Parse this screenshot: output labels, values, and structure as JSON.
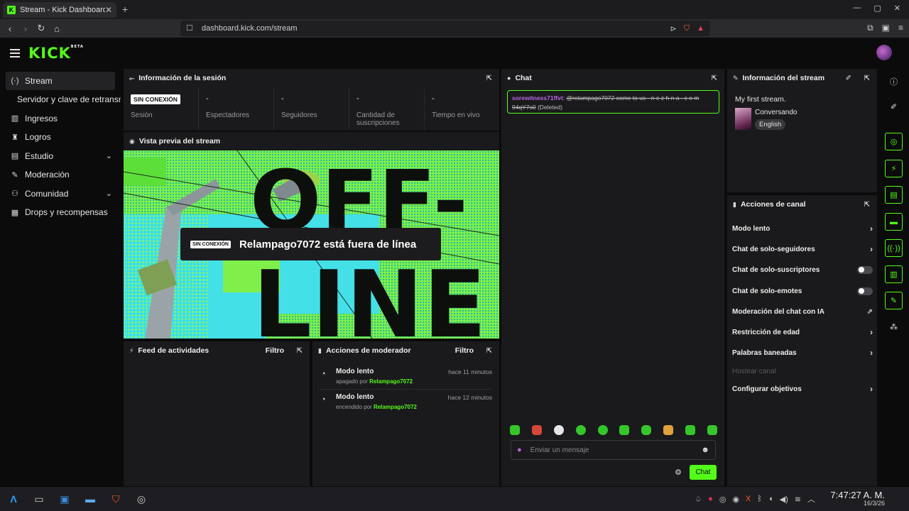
{
  "browser": {
    "tab_title": "Stream - Kick Dashboard",
    "tab_favicon": "K",
    "url": "dashboard.kick.com/stream"
  },
  "app": {
    "logo": "KICK",
    "logo_badge": "BETA"
  },
  "sidebar": {
    "items": [
      {
        "label": "Stream",
        "icon": "broadcast-icon"
      },
      {
        "label": "Servidor y clave de retransmisión"
      },
      {
        "label": "Ingresos",
        "icon": "chart-icon"
      },
      {
        "label": "Logros",
        "icon": "trophy-icon"
      },
      {
        "label": "Estudio",
        "icon": "studio-icon"
      },
      {
        "label": "Moderación",
        "icon": "wrench-icon"
      },
      {
        "label": "Comunidad",
        "icon": "people-icon"
      },
      {
        "label": "Drops y recompensas",
        "icon": "gift-icon"
      }
    ]
  },
  "session": {
    "title": "Información de la sesión",
    "status_badge": "SIN CONEXIÓN",
    "stats": [
      {
        "value": "",
        "label": "Sesión"
      },
      {
        "value": "-",
        "label": "Espectadores"
      },
      {
        "value": "-",
        "label": "Seguidores"
      },
      {
        "value": "-",
        "label": "Cantidad de suscripciones"
      },
      {
        "value": "-",
        "label": "Tiempo en vivo"
      }
    ]
  },
  "preview": {
    "title": "Vista previa del stream",
    "badge": "SIN CONEXIÓN",
    "message": "Relampago7072 está fuera de línea",
    "bg_text_1": "OFF-",
    "bg_text_2": "LINE"
  },
  "activity": {
    "title": "Feed de actividades",
    "filter": "Filtro"
  },
  "mod_actions": {
    "title": "Acciones de moderador",
    "filter": "Filtro",
    "items": [
      {
        "title": "Modo lento",
        "action": "apagado por",
        "user": "Relampago7072",
        "time": "hace 11 minutos"
      },
      {
        "title": "Modo lento",
        "action": "encendido por",
        "user": "Relampago7072",
        "time": "hace 12 minutos"
      }
    ]
  },
  "chat": {
    "title": "Chat",
    "message_user": "sorewitness71ffvt",
    "message_text": "@relampago7072 come to us - n e z h n a . c o m 94qY7s0",
    "message_status": "(Deleted)",
    "input_placeholder": "Enviar un mensaje",
    "send_label": "Chat"
  },
  "stream_info": {
    "title": "Información del stream",
    "stream_title": "My first stream.",
    "category": "Conversando",
    "language": "English"
  },
  "channel_actions": {
    "title": "Acciones de canal",
    "items": [
      {
        "label": "Modo lento",
        "control": "arrow"
      },
      {
        "label": "Chat de solo-seguidores",
        "control": "arrow"
      },
      {
        "label": "Chat de solo-suscriptores",
        "control": "toggle"
      },
      {
        "label": "Chat de solo-emotes",
        "control": "toggle"
      },
      {
        "label": "Moderación del chat con IA",
        "control": "external"
      },
      {
        "label": "Restricción de edad",
        "control": "arrow"
      },
      {
        "label": "Palabras baneadas",
        "control": "arrow"
      },
      {
        "label": "Hostear canal",
        "control": "none"
      },
      {
        "label": "Configurar objetivos",
        "control": "arrow"
      }
    ]
  },
  "taskbar": {
    "time": "7:47:27 A. M.",
    "date": "16/3/26"
  },
  "colors": {
    "brand": "#53fc18",
    "panel": "#1a1a1c",
    "username": "#b865e0"
  }
}
